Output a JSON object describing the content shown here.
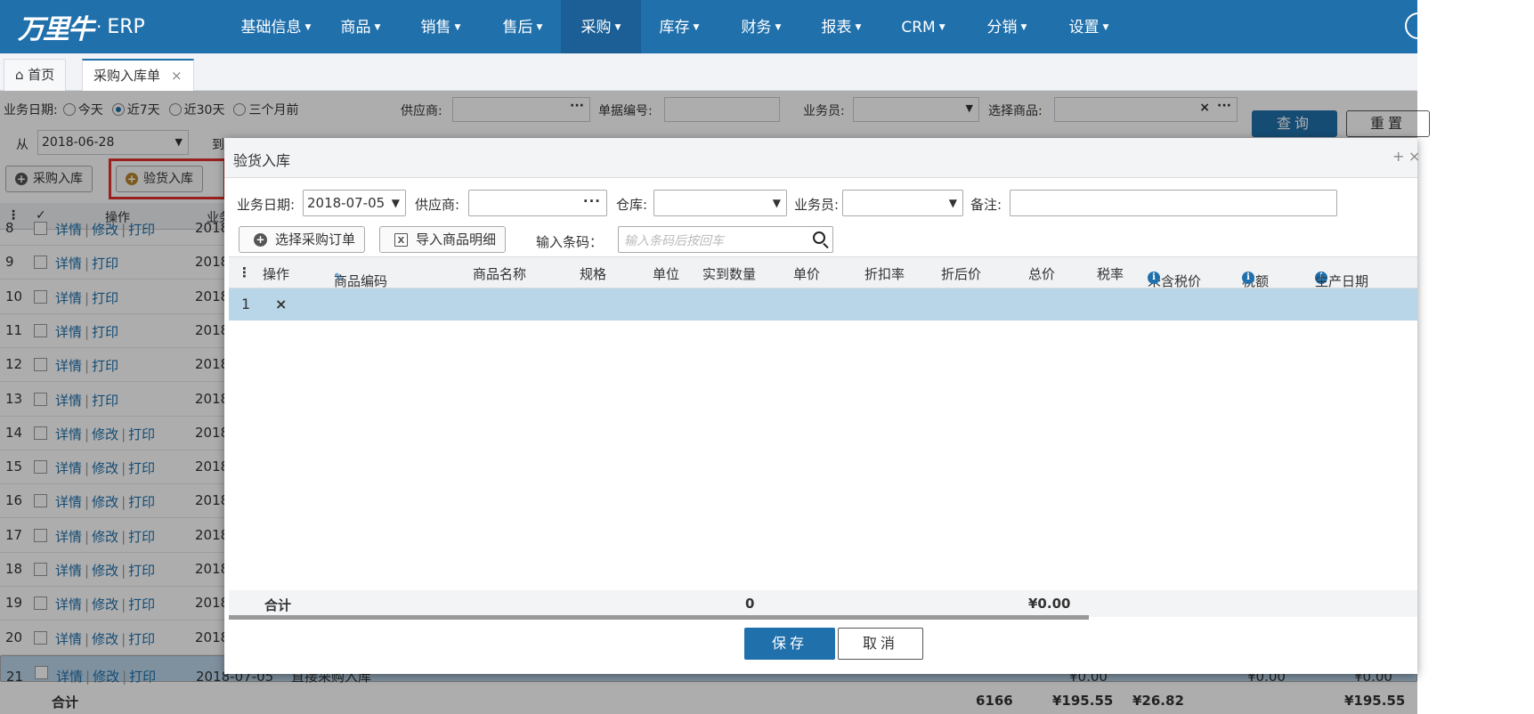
{
  "app": {
    "logo_mark": "万里牛",
    "logo_suffix": "ERP"
  },
  "nav": {
    "items": [
      "基础信息",
      "商品",
      "销售",
      "售后",
      "采购",
      "库存",
      "财务",
      "报表",
      "CRM",
      "分销",
      "设置"
    ],
    "active": "采购"
  },
  "tabs": {
    "home": "首页",
    "current": "采购入库单",
    "close": "×"
  },
  "filters": {
    "biz_date_label": "业务日期:",
    "ranges": [
      "今天",
      "近7天",
      "近30天",
      "三个月前"
    ],
    "selected_range": "近7天",
    "supplier_label": "供应商:",
    "doc_no_label": "单据编号:",
    "staff_label": "业务员:",
    "product_label": "选择商品:",
    "from_label": "从",
    "from_value": "2018-06-28",
    "to_label": "到",
    "query_button": "查询",
    "reset_button": "重置"
  },
  "toolbar": {
    "purchase_in": "采购入库",
    "inspect_in": "验货入库"
  },
  "list": {
    "header_op": "操作",
    "header_date_partial": "业务",
    "rows": [
      {
        "num": "8",
        "ops": [
          "详情",
          "修改",
          "打印"
        ],
        "date": "2018"
      },
      {
        "num": "9",
        "ops": [
          "详情",
          "打印"
        ],
        "date": "2018"
      },
      {
        "num": "10",
        "ops": [
          "详情",
          "打印"
        ],
        "date": "2018"
      },
      {
        "num": "11",
        "ops": [
          "详情",
          "打印"
        ],
        "date": "2018"
      },
      {
        "num": "12",
        "ops": [
          "详情",
          "打印"
        ],
        "date": "2018"
      },
      {
        "num": "13",
        "ops": [
          "详情",
          "打印"
        ],
        "date": "2018"
      },
      {
        "num": "14",
        "ops": [
          "详情",
          "修改",
          "打印"
        ],
        "date": "2018"
      },
      {
        "num": "15",
        "ops": [
          "详情",
          "修改",
          "打印"
        ],
        "date": "2018"
      },
      {
        "num": "16",
        "ops": [
          "详情",
          "修改",
          "打印"
        ],
        "date": "2018"
      },
      {
        "num": "17",
        "ops": [
          "详情",
          "修改",
          "打印"
        ],
        "date": "2018"
      },
      {
        "num": "18",
        "ops": [
          "详情",
          "修改",
          "打印"
        ],
        "date": "2018"
      },
      {
        "num": "19",
        "ops": [
          "详情",
          "修改",
          "打印"
        ],
        "date": "2018"
      },
      {
        "num": "20",
        "ops": [
          "详情",
          "修改",
          "打印"
        ],
        "date": "2018"
      },
      {
        "num": "21",
        "ops": [
          "详情",
          "修改",
          "打印"
        ],
        "date": "2018-07-05",
        "type": "直接采购入库",
        "amount1": "¥0.00",
        "amount2": "¥0.00",
        "amount3": "¥0.00"
      }
    ],
    "totals": {
      "label": "合计",
      "qty": "6166",
      "amount": "¥195.55",
      "tax": "¥26.82",
      "total": "¥195.55"
    }
  },
  "modal": {
    "title": "验货入库",
    "max": "+",
    "close": "×",
    "date_label": "业务日期:",
    "date_value": "2018-07-05",
    "supplier_label": "供应商:",
    "warehouse_label": "仓库:",
    "staff_label": "业务员:",
    "remark_label": "备注:",
    "select_po_button": "选择采购订单",
    "import_button": "导入商品明细",
    "barcode_label": "输入条码：",
    "barcode_placeholder": "输入条码后按回车",
    "columns": [
      "操作",
      "商品编码",
      "商品名称",
      "规格",
      "单位",
      "实到数量",
      "单价",
      "折扣率",
      "折后价",
      "总价",
      "税率",
      "未含税价",
      "税额",
      "生产日期"
    ],
    "row": {
      "num": "1",
      "delete": "×"
    },
    "sum": {
      "label": "合计",
      "qty": "0",
      "total": "¥0.00"
    },
    "save_button": "保存",
    "cancel_button": "取消"
  }
}
